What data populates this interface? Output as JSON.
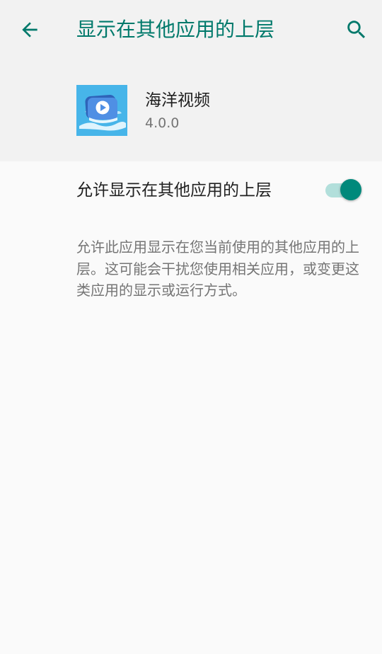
{
  "toolbar": {
    "title": "显示在其他应用的上层",
    "back_icon": "arrow-back-icon",
    "search_icon": "search-icon"
  },
  "app": {
    "name": "海洋视频",
    "version": "4.0.0",
    "icon": "video-play-app-icon"
  },
  "setting": {
    "label": "允许显示在其他应用的上层",
    "enabled": true,
    "description": "允许此应用显示在您当前使用的其他应用的上层。这可能会干扰您使用相关应用，或变更这类应用的显示或运行方式。"
  },
  "colors": {
    "accent": "#00796b",
    "header_bg": "#f2f2f2",
    "page_bg": "#fafafa",
    "toggle_thumb": "#00897b",
    "toggle_track": "#b2dfdb",
    "app_icon_bg": "#47b5e9"
  }
}
